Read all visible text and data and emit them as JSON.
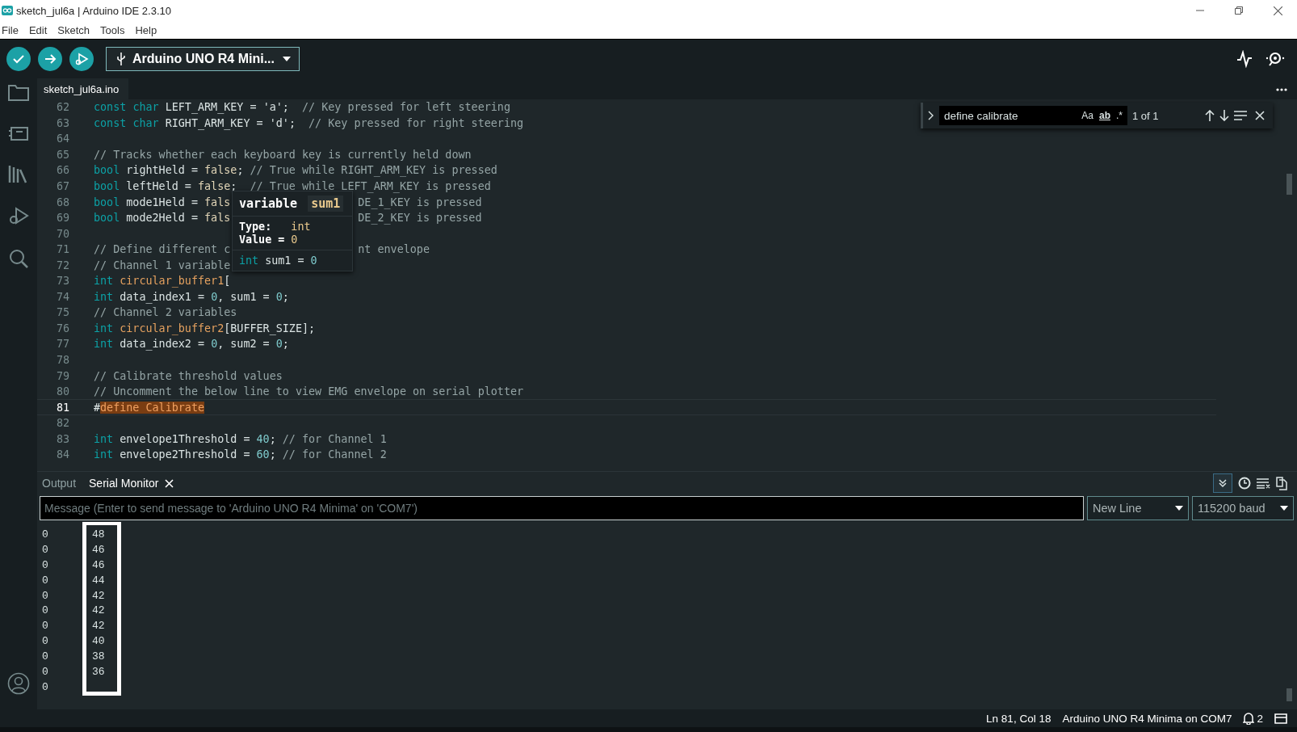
{
  "window": {
    "title": "sketch_jul6a | Arduino IDE 2.3.10"
  },
  "menu": [
    "File",
    "Edit",
    "Sketch",
    "Tools",
    "Help"
  ],
  "board_selector": {
    "label": "Arduino UNO R4 Mini..."
  },
  "editor_tab": {
    "label": "sketch_jul6a.ino"
  },
  "find": {
    "value": "define calibrate",
    "options": [
      "Aa",
      "ab",
      ".*"
    ],
    "count": "1 of 1"
  },
  "lines": [
    {
      "n": "62",
      "current": false,
      "tokens": [
        {
          "kind": "kw",
          "text": "const "
        },
        {
          "kind": "kw",
          "text": "char"
        },
        {
          "kind": "id",
          "text": " LEFT_ARM_KEY = "
        },
        {
          "kind": "str",
          "text": "'a'"
        },
        {
          "kind": "id",
          "text": ";  "
        },
        {
          "kind": "cm",
          "text": "// Key pressed for left steering"
        }
      ]
    },
    {
      "n": "63",
      "current": false,
      "tokens": [
        {
          "kind": "kw",
          "text": "const "
        },
        {
          "kind": "kw",
          "text": "char"
        },
        {
          "kind": "id",
          "text": " RIGHT_ARM_KEY = "
        },
        {
          "kind": "str",
          "text": "'d'"
        },
        {
          "kind": "id",
          "text": ";  "
        },
        {
          "kind": "cm",
          "text": "// Key pressed for right steering"
        }
      ]
    },
    {
      "n": "64",
      "current": false
    },
    {
      "n": "65",
      "current": false,
      "tokens": [
        {
          "kind": "cm",
          "text": "// Tracks whether each keyboard key is currently held down"
        }
      ]
    },
    {
      "n": "66",
      "current": false,
      "tokens": [
        {
          "kind": "kw",
          "text": "bool"
        },
        {
          "kind": "id",
          "text": " rightHeld = "
        },
        {
          "kind": "lit",
          "text": "false"
        },
        {
          "kind": "id",
          "text": "; "
        },
        {
          "kind": "cm",
          "text": "// True while RIGHT_ARM_KEY is pressed"
        }
      ]
    },
    {
      "n": "67",
      "current": false,
      "tokens": [
        {
          "kind": "kw",
          "text": "bool"
        },
        {
          "kind": "id",
          "text": " leftHeld = "
        },
        {
          "kind": "lit",
          "text": "false"
        },
        {
          "kind": "id",
          "text": ";  "
        },
        {
          "kind": "cm",
          "text": "// True while LEFT_ARM_KEY is pressed"
        }
      ]
    },
    {
      "n": "68",
      "current": false,
      "tokens": [
        {
          "kind": "kw",
          "text": "bool"
        },
        {
          "kind": "id",
          "text": " mode1Held = "
        },
        {
          "kind": "lit",
          "text": "fals"
        }
      ],
      "after": [
        {
          "kind": "cm",
          "text": "DE_1_KEY is pressed"
        }
      ]
    },
    {
      "n": "69",
      "current": false,
      "tokens": [
        {
          "kind": "kw",
          "text": "bool"
        },
        {
          "kind": "id",
          "text": " mode2Held = "
        },
        {
          "kind": "lit",
          "text": "fals"
        }
      ],
      "after": [
        {
          "kind": "cm",
          "text": "DE_2_KEY is pressed"
        }
      ]
    },
    {
      "n": "70",
      "current": false
    },
    {
      "n": "71",
      "current": false,
      "tokens": [
        {
          "kind": "cm",
          "text": "// Define different c"
        }
      ],
      "after": [
        {
          "kind": "cm",
          "text": "nt envelope"
        }
      ]
    },
    {
      "n": "72",
      "current": false,
      "tokens": [
        {
          "kind": "cm",
          "text": "// Channel 1 variable"
        }
      ]
    },
    {
      "n": "73",
      "current": false,
      "tokens": [
        {
          "kind": "kw",
          "text": "int "
        },
        {
          "kind": "fn",
          "text": "circular_buffer1"
        },
        {
          "kind": "id",
          "text": "["
        }
      ]
    },
    {
      "n": "74",
      "current": false,
      "tokens": [
        {
          "kind": "kw",
          "text": "int"
        },
        {
          "kind": "id",
          "text": " data_index1 = "
        },
        {
          "kind": "num",
          "text": "0"
        },
        {
          "kind": "id",
          "text": ", sum1 = "
        },
        {
          "kind": "num",
          "text": "0"
        },
        {
          "kind": "id",
          "text": ";"
        }
      ]
    },
    {
      "n": "75",
      "current": false,
      "tokens": [
        {
          "kind": "cm",
          "text": "// Channel 2 variables"
        }
      ]
    },
    {
      "n": "76",
      "current": false,
      "tokens": [
        {
          "kind": "kw",
          "text": "int "
        },
        {
          "kind": "fn",
          "text": "circular_buffer2"
        },
        {
          "kind": "id",
          "text": "[BUFFER_SIZE];"
        }
      ]
    },
    {
      "n": "77",
      "current": false,
      "tokens": [
        {
          "kind": "kw",
          "text": "int"
        },
        {
          "kind": "id",
          "text": " data_index2 = "
        },
        {
          "kind": "num",
          "text": "0"
        },
        {
          "kind": "id",
          "text": ", sum2 = "
        },
        {
          "kind": "num",
          "text": "0"
        },
        {
          "kind": "id",
          "text": ";"
        }
      ]
    },
    {
      "n": "78",
      "current": false
    },
    {
      "n": "79",
      "current": false,
      "tokens": [
        {
          "kind": "cm",
          "text": "// Calibrate threshold values"
        }
      ]
    },
    {
      "n": "80",
      "current": false,
      "tokens": [
        {
          "kind": "cm",
          "text": "// Uncomment the below line to view EMG envelope on serial plotter"
        }
      ]
    },
    {
      "n": "81",
      "current": true,
      "tokens": [
        {
          "kind": "id",
          "text": "#"
        },
        {
          "kind": "match",
          "text": "define Calibrate"
        }
      ]
    },
    {
      "n": "82",
      "current": false
    },
    {
      "n": "83",
      "current": false,
      "tokens": [
        {
          "kind": "kw",
          "text": "int"
        },
        {
          "kind": "id",
          "text": " envelope1Threshold = "
        },
        {
          "kind": "num",
          "text": "40"
        },
        {
          "kind": "id",
          "text": "; "
        },
        {
          "kind": "cm",
          "text": "// for Channel 1"
        }
      ]
    },
    {
      "n": "84",
      "current": false,
      "tokens": [
        {
          "kind": "kw",
          "text": "int"
        },
        {
          "kind": "id",
          "text": " envelope2Threshold = "
        },
        {
          "kind": "num",
          "text": "60"
        },
        {
          "kind": "id",
          "text": "; "
        },
        {
          "kind": "cm",
          "text": "// for Channel 2"
        }
      ]
    }
  ],
  "hover": {
    "kind": "variable",
    "name": "sum1",
    "type_label": "Type:",
    "type": "int",
    "value_label": "Value =",
    "value": "0",
    "signature": [
      {
        "kind": "kw",
        "text": "int"
      },
      {
        "kind": "id",
        "text": " sum1 = "
      },
      {
        "kind": "num",
        "text": "0"
      }
    ]
  },
  "panel": {
    "tabs": [
      {
        "label": "Output",
        "selected": false
      },
      {
        "label": "Serial Monitor",
        "selected": true
      }
    ],
    "autoscroll": true,
    "message": {
      "placeholder": "Message (Enter to send message to 'Arduino UNO R4 Minima' on 'COM7')"
    },
    "line_ending": "New Line",
    "baud": "115200 baud",
    "rows": [
      [
        "0",
        "48"
      ],
      [
        "0",
        "46"
      ],
      [
        "0",
        "46"
      ],
      [
        "0",
        "44"
      ],
      [
        "0",
        "42"
      ],
      [
        "0",
        "42"
      ],
      [
        "0",
        "42"
      ],
      [
        "0",
        "40"
      ],
      [
        "0",
        "38"
      ],
      [
        "0",
        "36"
      ],
      [
        "0"
      ]
    ]
  },
  "status_bar": {
    "position": "Ln 81, Col 18",
    "board": "Arduino UNO R4 Minima on COM7",
    "notifications": "2"
  }
}
